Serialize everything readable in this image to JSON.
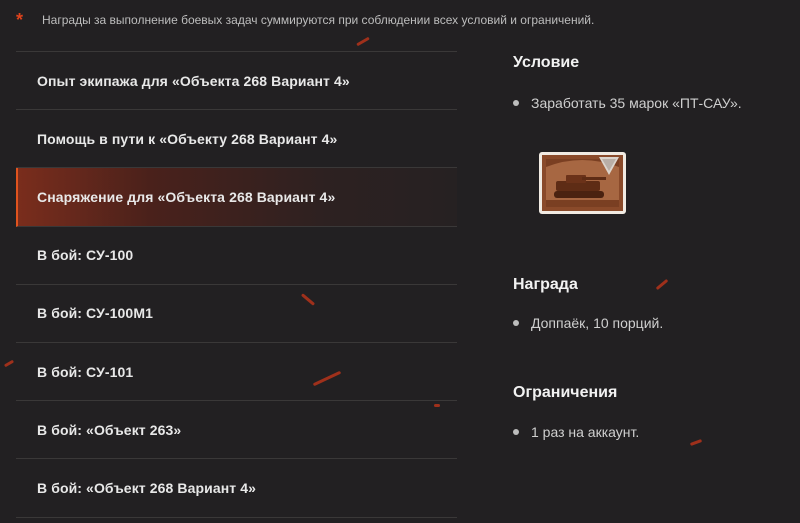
{
  "note": {
    "marker": "*",
    "text": "Награды за выполнение боевых задач суммируются при соблюдении всех условий и ограничений."
  },
  "tasks": [
    {
      "label": "Опыт экипажа для «Объекта 268 Вариант 4»",
      "active": false
    },
    {
      "label": "Помощь в пути к «Объекту 268 Вариант 4»",
      "active": false
    },
    {
      "label": "Снаряжение для «Объекта 268 Вариант 4»",
      "active": true
    },
    {
      "label": "В бой: СУ-100",
      "active": false
    },
    {
      "label": "В бой: СУ-100М1",
      "active": false
    },
    {
      "label": "В бой: СУ-101",
      "active": false
    },
    {
      "label": "В бой: «Объект 263»",
      "active": false
    },
    {
      "label": "В бой: «Объект 268 Вариант 4»",
      "active": false
    }
  ],
  "details": {
    "condition": {
      "title": "Условие",
      "item": "Заработать 35 марок «ПТ-САУ».",
      "icon": "td-stamp-icon"
    },
    "reward": {
      "title": "Награда",
      "item": "Доппаёк, 10 порций."
    },
    "limits": {
      "title": "Ограничения",
      "item": "1 раз на аккаунт."
    }
  },
  "colors": {
    "background": "#222022",
    "accent": "#e0531e",
    "divider": "#3a3838",
    "stamp": "#8a4a2a"
  }
}
